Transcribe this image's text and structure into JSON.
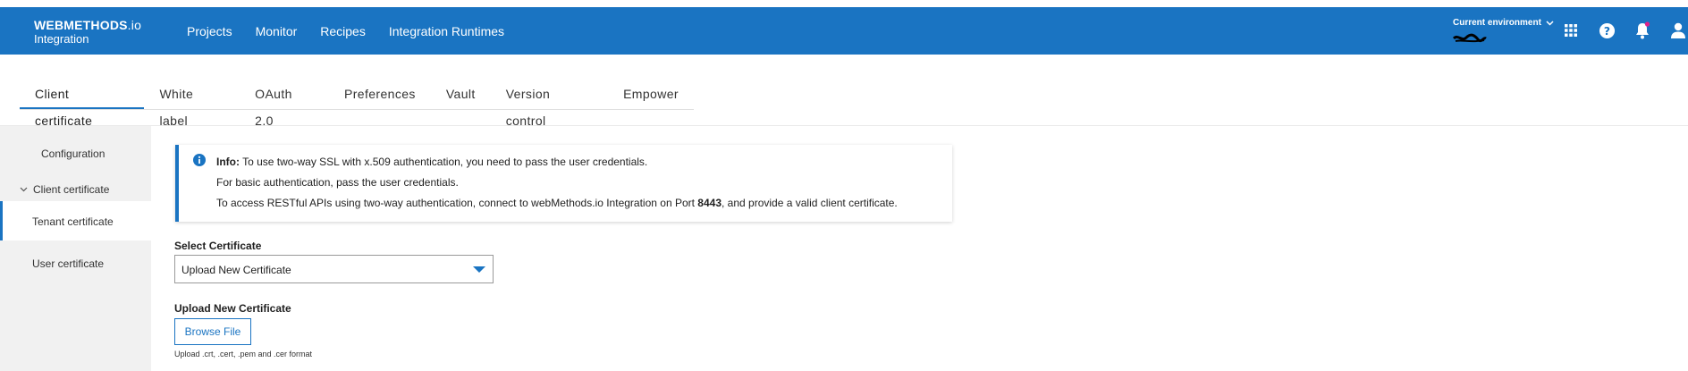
{
  "header": {
    "brand_name": "WEBMETHODS",
    "brand_suffix": ".io",
    "brand_sub": "Integration",
    "nav": [
      "Projects",
      "Monitor",
      "Recipes",
      "Integration Runtimes"
    ],
    "env_label": "Current environment",
    "icons": [
      "chevron-down-icon",
      "apps-grid-icon",
      "help-icon",
      "notification-bell-icon",
      "user-icon"
    ],
    "color": "#1a74c2",
    "notification_dot_color": "#e0218a"
  },
  "tabs": {
    "items": [
      "Client certificate",
      "White label",
      "OAuth 2.0",
      "Preferences",
      "Vault",
      "Version control",
      "Empower"
    ],
    "active": "Client certificate"
  },
  "sidebar": {
    "configuration": "Configuration",
    "client_certificate": "Client certificate",
    "tenant_certificate": "Tenant certificate",
    "user_certificate": "User certificate",
    "active": "Tenant certificate"
  },
  "info": {
    "prefix": "Info:",
    "line1": " To use two-way SSL with x.509 authentication, you need to pass the user credentials.",
    "line2": "For basic authentication, pass the user credentials.",
    "line3_pre": "To access RESTful APIs using two-way authentication, connect to webMethods.io Integration on Port ",
    "line3_port": "8443",
    "line3_post": ", and provide a valid client certificate."
  },
  "form": {
    "select_label": "Select Certificate",
    "select_value": "Upload New Certificate",
    "upload_label": "Upload New Certificate",
    "browse_button": "Browse File",
    "format_hint": "Upload .crt, .cert, .pem and .cer format"
  }
}
